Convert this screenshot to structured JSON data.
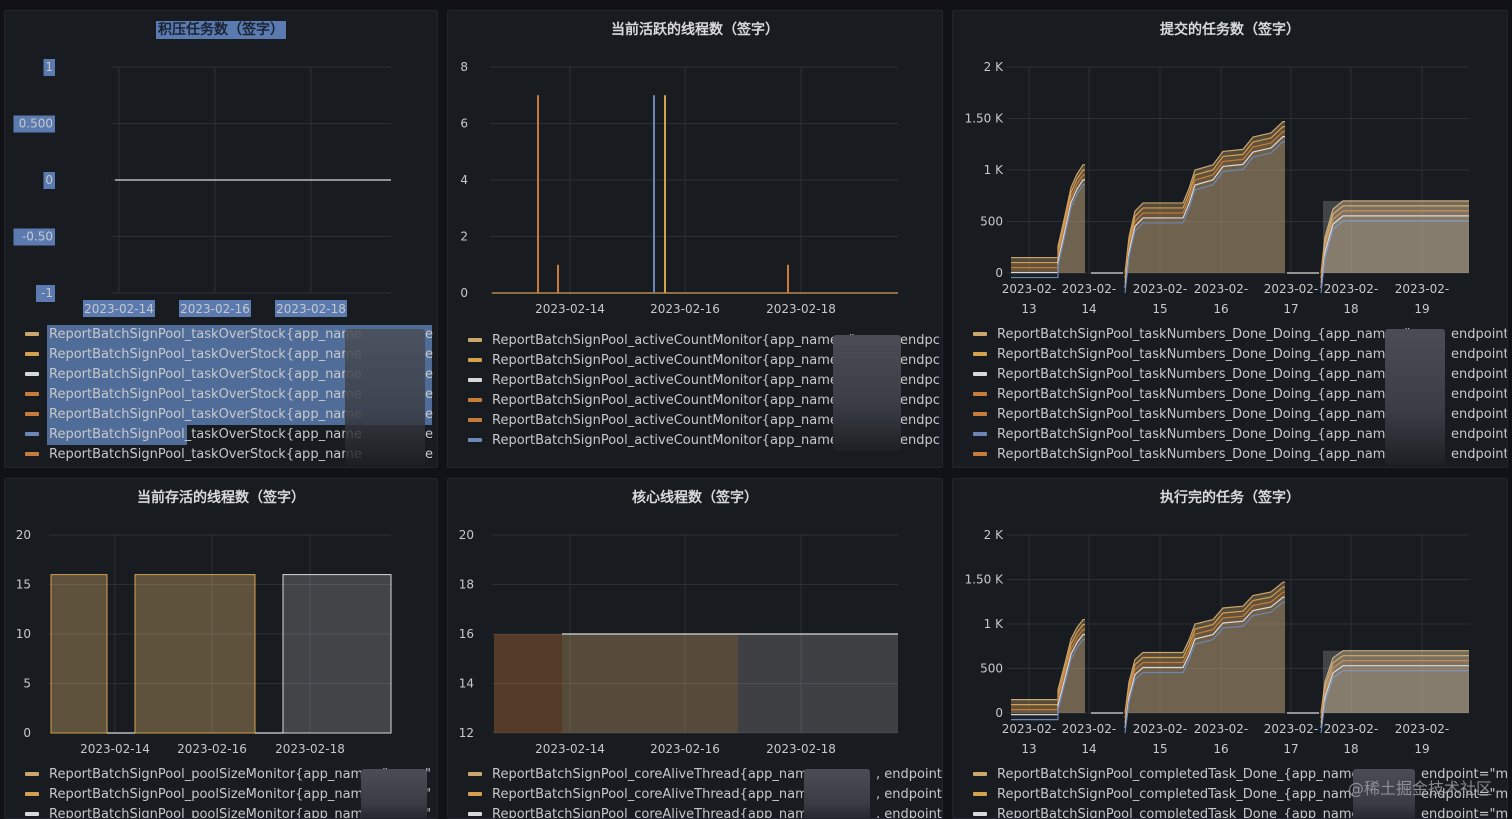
{
  "colors": {
    "bg": "#111217",
    "panel": "#181b1f",
    "grid": "#2c3036",
    "gold": "#d3a04e",
    "tan": "#caa56c",
    "blue": "#6c86b5",
    "white": "#d8d9da",
    "orange": "#c77c3b",
    "select": "#5b7bb0"
  },
  "watermark": "@稀土掘金技术社区",
  "panels": [
    {
      "title": "积压任务数（签字）",
      "y_ticks": [
        "1",
        "0.500",
        "0",
        "-0.50",
        "-1"
      ],
      "x_ticks": [
        "2023-02-14",
        "2023-02-16",
        "2023-02-18"
      ],
      "legend_name": "ReportBatchSignPool_taskOverStock{app_name",
      "legend_tail": "e",
      "legend_rows": 7
    },
    {
      "title": "当前活跃的线程数（签字）",
      "y_ticks": [
        "8",
        "6",
        "4",
        "2",
        "0"
      ],
      "x_ticks": [
        "2023-02-14",
        "2023-02-16",
        "2023-02-18"
      ],
      "legend_name": "ReportBatchSignPool_activeCountMonitor{app_name=\"v",
      "legend_tail": "endpc",
      "legend_rows": 6
    },
    {
      "title": "提交的任务数（签字）",
      "y_ticks": [
        "2 K",
        "1.50 K",
        "1 K",
        "500",
        "0"
      ],
      "x_ticks": [
        "2023-02-\n13",
        "2023-02-\n14",
        "2023-02-\n15",
        "2023-02-\n16",
        "2023-02-\n17",
        "2023-02-\n18",
        "2023-02-\n19"
      ],
      "legend_name": "ReportBatchSignPool_taskNumbers_Done_Doing_{app_name=\"",
      "legend_tail": "endpoint",
      "legend_rows": 7
    },
    {
      "title": "当前存活的线程数（签字）",
      "y_ticks": [
        "20",
        "15",
        "10",
        "5",
        "0"
      ],
      "x_ticks": [
        "2023-02-14",
        "2023-02-16",
        "2023-02-18"
      ],
      "legend_name": "ReportBatchSignPool_poolSizeMonitor{app_name=\"",
      "legend_tail": "\"",
      "legend_rows": 3
    },
    {
      "title": "核心线程数（签字）",
      "y_ticks": [
        "20",
        "18",
        "16",
        "14",
        "12"
      ],
      "x_ticks": [
        "2023-02-14",
        "2023-02-16",
        "2023-02-18"
      ],
      "legend_name": "ReportBatchSignPool_coreAliveThread{app_name=",
      "legend_tail": ", endpoint:",
      "legend_rows": 3
    },
    {
      "title": "执行完的任务（签字）",
      "y_ticks": [
        "2 K",
        "1.50 K",
        "1 K",
        "500",
        "0"
      ],
      "x_ticks": [
        "2023-02-\n13",
        "2023-02-\n14",
        "2023-02-\n15",
        "2023-02-\n16",
        "2023-02-\n17",
        "2023-02-\n18",
        "2023-02-\n19"
      ],
      "legend_name": "ReportBatchSignPool_completedTask_Done_{app_name=",
      "legend_tail": "endpoint=\"ma",
      "legend_rows": 3
    }
  ]
}
